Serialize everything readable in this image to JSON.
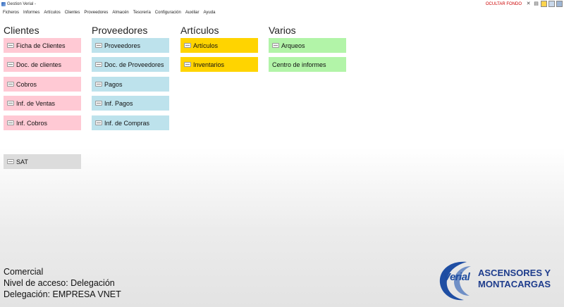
{
  "window": {
    "title": "Gestion Verial -",
    "ocultar_fondo": "OCULTAR FONDO"
  },
  "menu": [
    "Ficheros",
    "Informes",
    "Artículos",
    "Clientes",
    "Proveedores",
    "Almacén",
    "Tesorería",
    "Configuración",
    "Auxiliar",
    "Ayuda"
  ],
  "columns": {
    "clientes": {
      "title": "Clientes",
      "items": [
        "Ficha de Clientes",
        "Doc. de clientes",
        "Cobros",
        "Inf. de Ventas",
        "Inf. Cobros"
      ],
      "extra": "SAT"
    },
    "proveedores": {
      "title": "Proveedores",
      "items": [
        "Proveedores",
        "Doc. de Proveedores",
        "Pagos",
        "Inf. Pagos",
        "Inf. de Compras"
      ]
    },
    "articulos": {
      "title": "Artículos",
      "items": [
        "Artículos",
        "Inventarios"
      ]
    },
    "varios": {
      "title": "Varios",
      "items": [
        "Arqueos",
        "Centro de informes"
      ]
    }
  },
  "status": {
    "module": "Comercial",
    "access": "Nivel de acceso: Delegación",
    "delegation": "Delegación: EMPRESA VNET"
  },
  "logo": {
    "word": "Verial",
    "company_line1": "ASCENSORES Y",
    "company_line2": "MONTACARGAS"
  },
  "colors": {
    "clientes": "#ffc9d4",
    "proveedores": "#bde2ec",
    "articulos": "#ffd400",
    "varios": "#b2f4a8",
    "sat": "#dcdcdc",
    "ocultar": "#cc0000"
  }
}
